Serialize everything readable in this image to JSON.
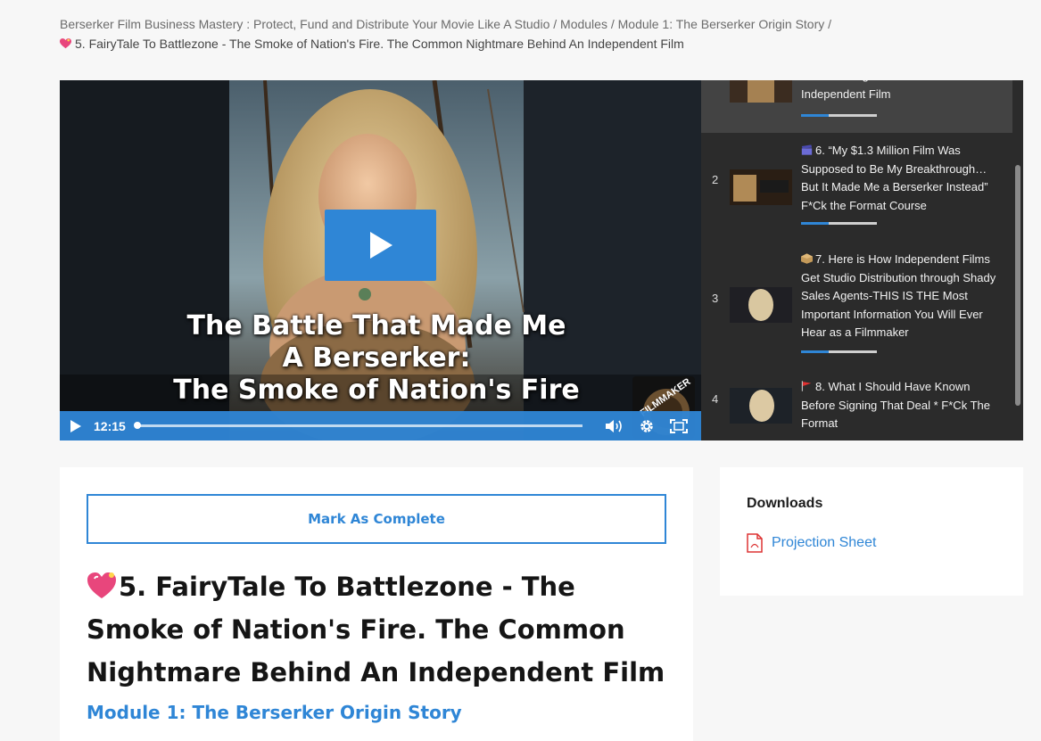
{
  "breadcrumb": {
    "items": [
      "Berserker Film Business Mastery : Protect, Fund and Distribute Your Movie Like A Studio",
      "Modules",
      "Module 1: The Berserker Origin Story"
    ],
    "separator": " / ",
    "current": "5. FairyTale To Battlezone - The Smoke of Nation's Fire. The Common Nightmare Behind An Independent Film"
  },
  "video": {
    "overlay_lines": [
      "The Battle That Made Me",
      "A Berserker:",
      "The Smoke of Nation's Fire"
    ],
    "logo_text": "FILMMAKER",
    "time": "12:15",
    "progress_fraction": 0.0,
    "accent_color": "#2f86d6"
  },
  "playlist": {
    "items": [
      {
        "number": "",
        "title": "Common Nightmare Behind An Independent Film",
        "emoji": "",
        "active": true
      },
      {
        "number": "2",
        "title": "6. “My $1.3 Million Film Was Supposed to Be My Breakthrough… But It Made Me a Berserker Instead” F*Ck the Format Course",
        "emoji": "clapperboard-icon",
        "active": false
      },
      {
        "number": "3",
        "title": "7. Here is How Independent Films Get Studio Distribution through Shady Sales Agents-THIS IS THE Most Important Information You Will Ever Hear as a Filmmaker",
        "emoji": "package-icon",
        "active": false
      },
      {
        "number": "4",
        "title": "8. What I Should Have Known Before Signing That Deal * F*Ck The Format",
        "emoji": "red-flag-icon",
        "active": false
      }
    ]
  },
  "lesson": {
    "mark_complete_label": "Mark As Complete",
    "title": "5. FairyTale To Battlezone - The Smoke of Nation's Fire. The Common Nightmare Behind An Independent Film",
    "module_link": "Module 1: The Berserker Origin Story"
  },
  "downloads": {
    "heading": "Downloads",
    "items": [
      {
        "label": "Projection Sheet",
        "icon": "pdf-file-icon"
      }
    ]
  }
}
